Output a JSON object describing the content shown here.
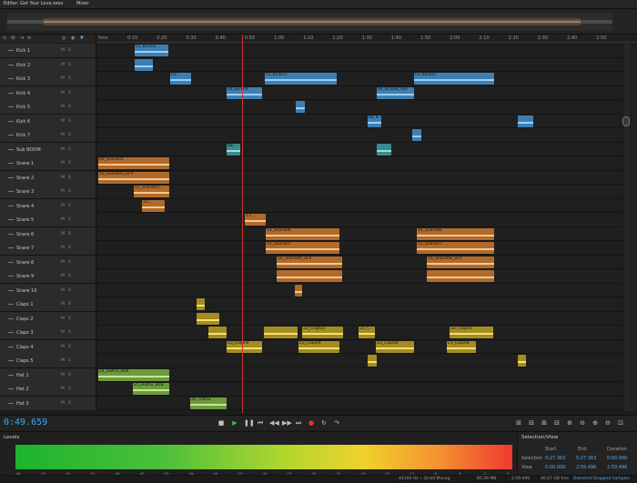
{
  "tabs": [
    {
      "label": "Editor: Got Your Love.sesx"
    },
    {
      "label": "Mixer"
    }
  ],
  "ruler": {
    "unit": "hms",
    "ticks": [
      "0:10",
      "0:20",
      "0:30",
      "0:40",
      "0:50",
      "1:00",
      "1:10",
      "1:20",
      "1:30",
      "1:40",
      "1:50",
      "2:00",
      "2:10",
      "2:20",
      "2:30",
      "2:40",
      "2:50"
    ]
  },
  "track_controls": {
    "mute": "M",
    "solo": "S"
  },
  "tracks": [
    {
      "name": "Kick 1",
      "type": "kick",
      "clips": [
        {
          "label": "01_Kick01",
          "start": 148,
          "end": 185
        }
      ]
    },
    {
      "name": "Kick 2",
      "type": "kick",
      "clips": [
        {
          "label": "",
          "start": 148,
          "end": 168
        }
      ]
    },
    {
      "name": "Kick 3",
      "type": "kick",
      "clips": [
        {
          "label": "03...",
          "start": 187,
          "end": 210
        },
        {
          "label": "03_Kick03",
          "start": 291,
          "end": 370
        },
        {
          "label": "03_Kick03",
          "start": 455,
          "end": 543
        }
      ]
    },
    {
      "name": "Kick 4",
      "type": "kick",
      "clips": [
        {
          "label": "04_Kick04",
          "start": 249,
          "end": 288
        },
        {
          "label": "04_Kick04_Pan",
          "start": 414,
          "end": 455
        }
      ]
    },
    {
      "name": "Kick 5",
      "type": "kick",
      "clips": [
        {
          "label": "",
          "start": 325,
          "end": 335
        }
      ]
    },
    {
      "name": "Kick 6",
      "type": "kick",
      "clips": [
        {
          "label": "06_K...",
          "start": 404,
          "end": 419
        },
        {
          "label": "",
          "start": 569,
          "end": 586
        }
      ]
    },
    {
      "name": "Kick 7",
      "type": "kick",
      "clips": [
        {
          "label": "",
          "start": 453,
          "end": 463
        }
      ]
    },
    {
      "name": "Sub BOOM",
      "type": "sub",
      "clips": [
        {
          "label": "08...",
          "start": 249,
          "end": 264
        },
        {
          "label": "",
          "start": 414,
          "end": 430
        }
      ]
    },
    {
      "name": "Snare 1",
      "type": "snare",
      "clips": [
        {
          "label": "09_Snare01",
          "start": 108,
          "end": 186
        }
      ]
    },
    {
      "name": "Snare 2",
      "type": "snare",
      "clips": [
        {
          "label": "10_Snare02_SFX",
          "start": 108,
          "end": 186
        }
      ]
    },
    {
      "name": "Snare 3",
      "type": "snare",
      "clips": [
        {
          "label": "11_Snare03...",
          "start": 147,
          "end": 186
        }
      ]
    },
    {
      "name": "Snare 4",
      "type": "snare",
      "clips": [
        {
          "label": "12...",
          "start": 156,
          "end": 181
        }
      ]
    },
    {
      "name": "Snare 5",
      "type": "snare",
      "clips": [
        {
          "label": "13...",
          "start": 269,
          "end": 292
        }
      ]
    },
    {
      "name": "Snare 6",
      "type": "snare",
      "clips": [
        {
          "label": "14_Snare06",
          "start": 292,
          "end": 373
        },
        {
          "label": "14_Snare06",
          "start": 458,
          "end": 543
        }
      ]
    },
    {
      "name": "Snare 7",
      "type": "snare",
      "clips": [
        {
          "label": "15_Snare07",
          "start": 292,
          "end": 373
        },
        {
          "label": "15_Snare07",
          "start": 458,
          "end": 543
        }
      ]
    },
    {
      "name": "Snare 8",
      "type": "snare",
      "clips": [
        {
          "label": "16_Snare08_SFX",
          "start": 304,
          "end": 376
        },
        {
          "label": "16_Snare08_SFX",
          "start": 469,
          "end": 543
        }
      ]
    },
    {
      "name": "Snare 9",
      "type": "snare",
      "clips": [
        {
          "label": "",
          "start": 304,
          "end": 376
        },
        {
          "label": "",
          "start": 469,
          "end": 543
        }
      ]
    },
    {
      "name": "Snare 10",
      "type": "snare",
      "clips": [
        {
          "label": "",
          "start": 324,
          "end": 332
        }
      ]
    },
    {
      "name": "Claps 1",
      "type": "clap",
      "clips": [
        {
          "label": "",
          "start": 216,
          "end": 225
        }
      ]
    },
    {
      "name": "Claps 2",
      "type": "clap",
      "clips": [
        {
          "label": "",
          "start": 216,
          "end": 241
        }
      ]
    },
    {
      "name": "Claps 3",
      "type": "clap",
      "clips": [
        {
          "label": "",
          "start": 229,
          "end": 249
        },
        {
          "label": "",
          "start": 290,
          "end": 327
        },
        {
          "label": "22_Clap03",
          "start": 332,
          "end": 377
        },
        {
          "label": "22_C...",
          "start": 394,
          "end": 412
        },
        {
          "label": "22_Clap03",
          "start": 494,
          "end": 542
        }
      ]
    },
    {
      "name": "Claps 4",
      "type": "clap",
      "clips": [
        {
          "label": "23_Clap04",
          "start": 249,
          "end": 288
        },
        {
          "label": "23_Clap04",
          "start": 328,
          "end": 373
        },
        {
          "label": "23_Clap04",
          "start": 413,
          "end": 455
        },
        {
          "label": "23_Clap04",
          "start": 491,
          "end": 523
        }
      ]
    },
    {
      "name": "Claps 5",
      "type": "clap",
      "clips": [
        {
          "label": "",
          "start": 404,
          "end": 414
        },
        {
          "label": "",
          "start": 569,
          "end": 578
        }
      ]
    },
    {
      "name": "Hat 1",
      "type": "hat",
      "clips": [
        {
          "label": "24_Hat01_808",
          "start": 108,
          "end": 186
        }
      ]
    },
    {
      "name": "Hat 2",
      "type": "hat",
      "clips": [
        {
          "label": "25_Hat02_808",
          "start": 146,
          "end": 186
        }
      ]
    },
    {
      "name": "Hat 3",
      "type": "hat",
      "clips": [
        {
          "label": "26_Hat03",
          "start": 209,
          "end": 249
        }
      ]
    }
  ],
  "transport": {
    "time": "0:49.659"
  },
  "levels": {
    "title": "Levels",
    "scale": [
      "dB",
      "-57",
      "-54",
      "-51",
      "-48",
      "-45",
      "-42",
      "-39",
      "-36",
      "-33",
      "-30",
      "-27",
      "-24",
      "-21",
      "-18",
      "-15",
      "-12",
      "-9",
      "-6",
      "-3",
      "0"
    ]
  },
  "selection_view": {
    "title": "Selection/View",
    "headers": {
      "start": "Start",
      "end": "End",
      "duration": "Duration"
    },
    "selection": {
      "label": "Selection",
      "start": "0:27.363",
      "end": "0:27.363",
      "duration": "0:00.000"
    },
    "view": {
      "label": "View",
      "start": "0:00.000",
      "end": "2:59.496",
      "duration": "2:59.496"
    }
  },
  "status": {
    "format": "44100 Hz • 32-bit Mixing",
    "memory": "60.39 MB",
    "duration": "2:59.496",
    "free": "46.67 GB free",
    "warning": "Detected Dropped Samples"
  },
  "colors": {
    "kick": "#3e7fb1",
    "sub": "#3b8a8d",
    "snare": "#b06a2b",
    "clap": "#a58c21",
    "hat": "#6d9b3c",
    "playhead": "#cc3333",
    "time": "#3fa7f5"
  }
}
